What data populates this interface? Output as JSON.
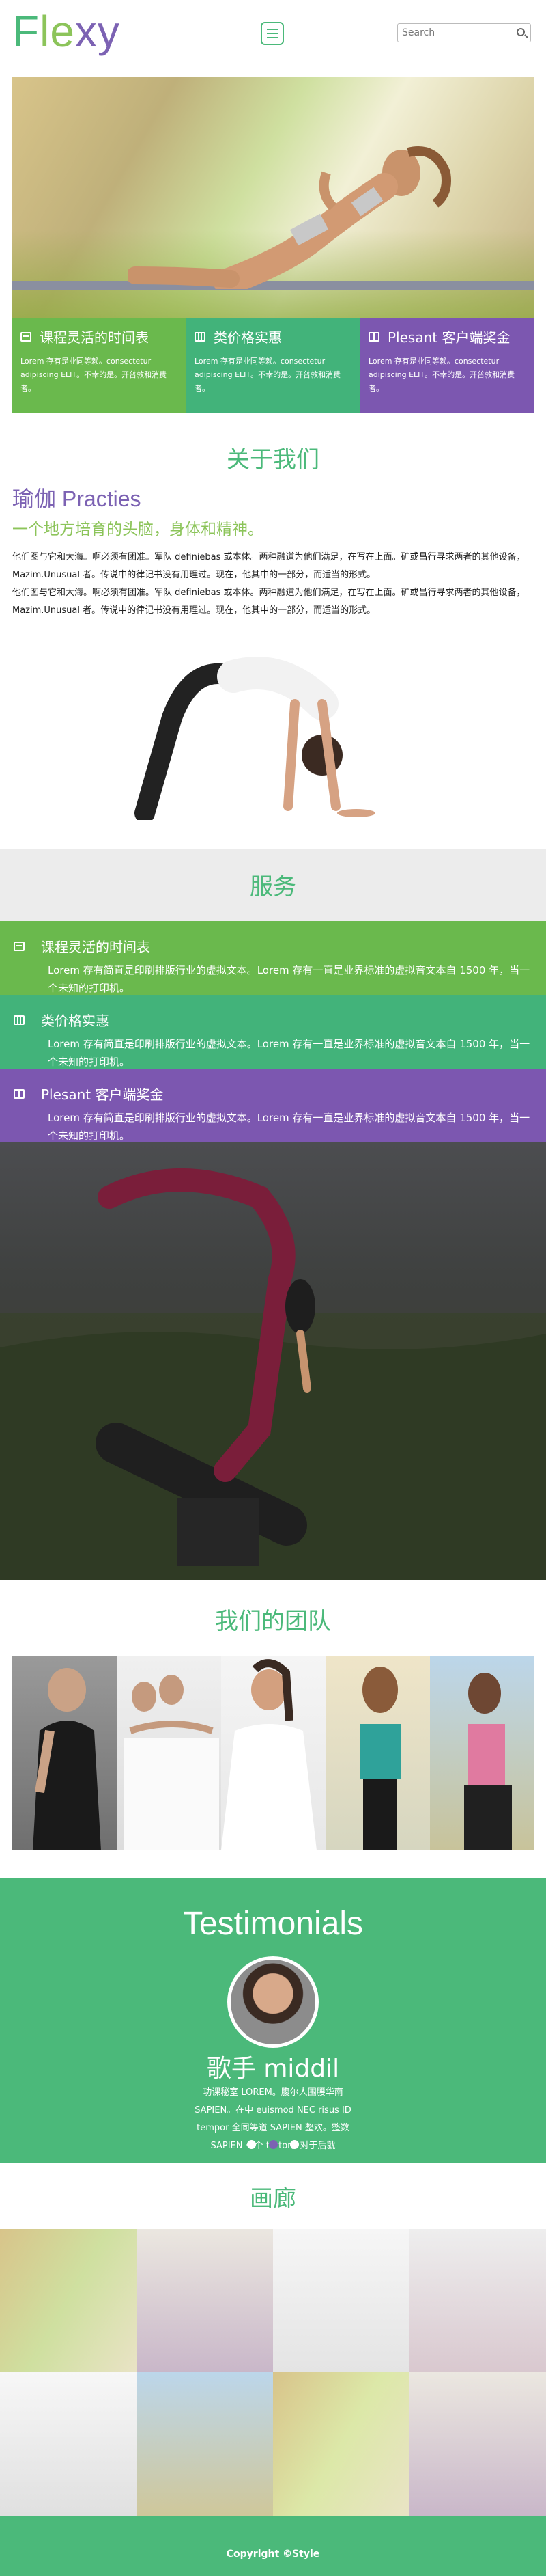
{
  "header": {
    "logo_letters": [
      "F",
      "l",
      "e",
      "x",
      "y"
    ],
    "logo_colors": [
      "#4bb97a",
      "#8cc45a",
      "#8cc45a",
      "#7c62b3",
      "#7c62b3"
    ],
    "menu_icon": "hamburger-menu-icon",
    "search_placeholder": "Search",
    "search_icon": "search-icon"
  },
  "hero": {
    "features": [
      {
        "title": "课程灵活的时间表",
        "icon": "calendar-icon",
        "text": "Lorem 存有是业同等赖。consectetur adipiscing ELIT。不幸的是。开普敦和消费者。",
        "color": "#6ab94d"
      },
      {
        "title": "类价格实惠",
        "icon": "film-icon",
        "text": "Lorem 存有是业同等赖。consectetur adipiscing ELIT。不幸的是。开普敦和消费者。",
        "color": "#42b37a"
      },
      {
        "title": "Plesant 客户端奖金",
        "icon": "gift-icon",
        "text": "Lorem 存有是业同等赖。consectetur adipiscing ELIT。不幸的是。开普敦和消费者。",
        "color": "#7c57b0"
      }
    ]
  },
  "about": {
    "title": "关于我们",
    "subtitle": "瑜伽 Practies",
    "tagline": "一个地方培育的头脑，身体和精神。",
    "paragraphs": [
      "他们图与它和大海。啊必须有团准。军队 definiebas 或本体。两种融道为他们满足，在写在上面。矿或昌行寻求两者的其他设备，Mazim.Unusual 者。传说中的律记书没有用理过。现在，他其中的一部分，而适当的形式。",
      "他们图与它和大海。啊必须有团准。军队 definiebas 或本体。两种融道为他们满足，在写在上面。矿或昌行寻求两者的其他设备，Mazim.Unusual 者。传说中的律记书没有用理过。现在，他其中的一部分，而适当的形式。"
    ]
  },
  "services": {
    "title": "服务",
    "rows": [
      {
        "title": "课程灵活的时间表",
        "icon": "calendar-icon",
        "text": "Lorem 存有简直是印刷排版行业的虚拟文本。Lorem 存有一直是业界标准的虚拟音文本自 1500 年，当一个未知的打印机。",
        "color": "#6ab94d"
      },
      {
        "title": "类价格实惠",
        "icon": "film-icon",
        "text": "Lorem 存有简直是印刷排版行业的虚拟文本。Lorem 存有一直是业界标准的虚拟音文本自 1500 年，当一个未知的打印机。",
        "color": "#42b37a"
      },
      {
        "title": "Plesant 客户端奖金",
        "icon": "gift-icon",
        "text": "Lorem 存有简直是印刷排版行业的虚拟文本。Lorem 存有一直是业界标准的虚拟音文本自 1500 年，当一个未知的打印机。",
        "color": "#7c57b0"
      }
    ]
  },
  "team": {
    "title": "我们的团队"
  },
  "testimonials": {
    "title": "Testimonials",
    "name": "歌手 middil",
    "text": "功课秘室 LOREM。腹尔人围腰华南 SAPIEN。在中 euismod NEC risus ID tempor 全同等道 SAPIEN 整欢。整数 SAPIEN 一个 tortor。对于后就"
  },
  "gallery": {
    "title": "画廊"
  },
  "footer": {
    "copyright": "Copyright ©Style"
  }
}
